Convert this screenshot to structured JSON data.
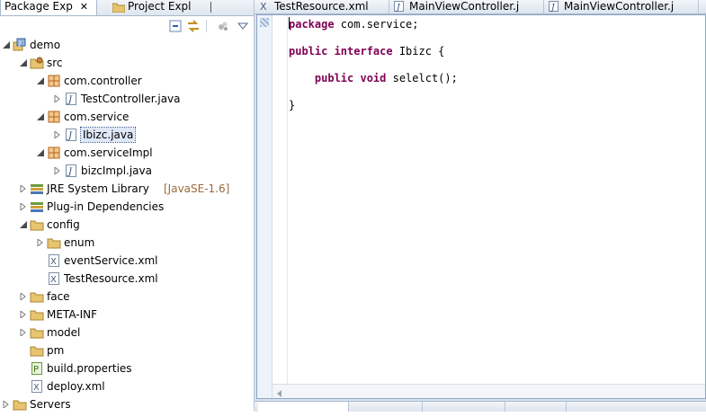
{
  "package_explorer": {
    "tabs": [
      {
        "label": "Package Exp",
        "close": "✕"
      },
      {
        "label": "Project Expl"
      }
    ],
    "tree": [
      {
        "label": "demo",
        "icon": "java-project-icon",
        "expanded": true,
        "level": 0
      },
      {
        "label": "src",
        "icon": "source-folder-icon",
        "expanded": true,
        "level": 1
      },
      {
        "label": "com.controller",
        "icon": "package-icon",
        "expanded": true,
        "level": 2
      },
      {
        "label": "TestController.java",
        "icon": "java-file-icon",
        "expanded": false,
        "level": 3
      },
      {
        "label": "com.service",
        "icon": "package-icon",
        "expanded": true,
        "level": 2
      },
      {
        "label": "Ibizc.java",
        "icon": "java-file-icon",
        "expanded": false,
        "level": 3,
        "selected": true
      },
      {
        "label": "com.serviceImpl",
        "icon": "package-icon",
        "expanded": true,
        "level": 2
      },
      {
        "label": "bizcImpl.java",
        "icon": "java-file-icon",
        "expanded": false,
        "level": 3
      },
      {
        "label": "JRE System Library",
        "decoration": "[JavaSE-1.6]",
        "icon": "library-icon",
        "expanded": false,
        "level": 1
      },
      {
        "label": "Plug-in Dependencies",
        "icon": "library-icon",
        "expanded": false,
        "level": 1
      },
      {
        "label": "config",
        "icon": "folder-icon",
        "expanded": true,
        "level": 1
      },
      {
        "label": "enum",
        "icon": "folder-icon",
        "expanded": false,
        "level": 2
      },
      {
        "label": "eventService.xml",
        "icon": "xml-file-icon",
        "level": 2
      },
      {
        "label": "TestResource.xml",
        "icon": "xml-file-icon",
        "level": 2
      },
      {
        "label": "face",
        "icon": "folder-icon",
        "expanded": false,
        "level": 1
      },
      {
        "label": "META-INF",
        "icon": "folder-icon",
        "expanded": false,
        "level": 1
      },
      {
        "label": "model",
        "icon": "folder-icon",
        "expanded": false,
        "level": 1
      },
      {
        "label": "pm",
        "icon": "folder-icon",
        "level": 1
      },
      {
        "label": "build.properties",
        "icon": "properties-file-icon",
        "level": 1
      },
      {
        "label": "deploy.xml",
        "icon": "xml-file-icon",
        "level": 1
      },
      {
        "label": "Servers",
        "icon": "folder-icon",
        "expanded": false,
        "level": 0
      }
    ]
  },
  "editor": {
    "tabs": [
      {
        "label": "TestResource.xml"
      },
      {
        "label": "MainViewController.j"
      },
      {
        "label": "MainViewController.j"
      }
    ],
    "code_lines": [
      {
        "kw": "package",
        "rest": " com.service;"
      },
      {
        "kw": "",
        "rest": ""
      },
      {
        "kw": "public interface",
        "rest": " Ibizc {"
      },
      {
        "kw": "",
        "rest": ""
      },
      {
        "kw": "    public void",
        "rest": " selelct();"
      },
      {
        "kw": "",
        "rest": ""
      },
      {
        "kw": "",
        "rest": "}"
      }
    ]
  },
  "colors": {
    "keyword": "#7f0055",
    "selection": "#3399ff",
    "decoration": "#9b6a3a"
  }
}
